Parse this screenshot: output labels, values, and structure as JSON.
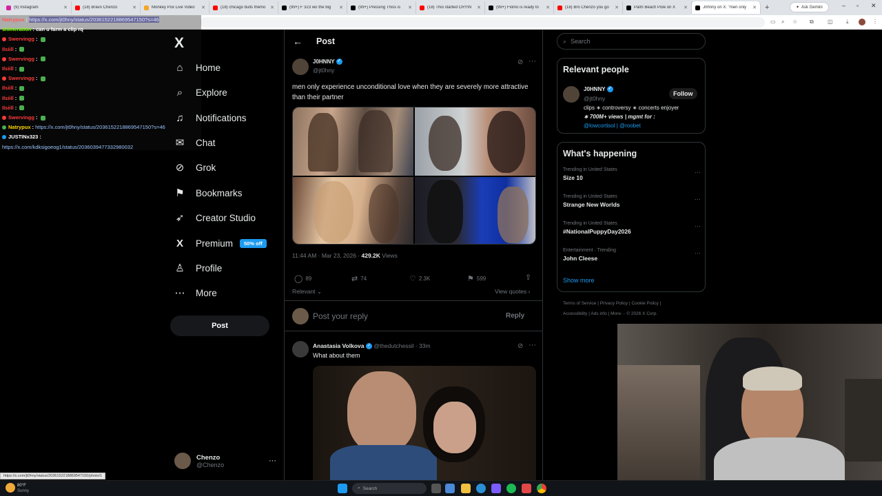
{
  "browser": {
    "tabs": [
      {
        "label": "(9) Instagram",
        "color": "#d6249f"
      },
      {
        "label": "(18) Bravo Chenzo",
        "color": "#ff0000"
      },
      {
        "label": "Monkey Pox Live Video",
        "color": "#f5a623"
      },
      {
        "label": "(18) chicago bulls themo",
        "color": "#ff0000"
      },
      {
        "label": "(99+) F 323 wo the big",
        "color": "#000000"
      },
      {
        "label": "(99+) Pressing Thiss is",
        "color": "#000000"
      },
      {
        "label": "(18) Thio started CRYIN",
        "color": "#ff0000"
      },
      {
        "label": "(99+) Flomo is ready to",
        "color": "#000000"
      },
      {
        "label": "(18) Bro Chenzo you go",
        "color": "#ff0000"
      },
      {
        "label": "Palm Beach Pole on X",
        "color": "#000000"
      },
      {
        "label": "J0hnny on X: \"men only",
        "color": "#000000",
        "active": true
      }
    ],
    "new_tab": "+",
    "gemini_label": "Ask Gemini",
    "status_url": "https://x.com/jt0hny/status/2036152218869547150/photo/1"
  },
  "chat": [
    {
      "user": "Natrypux",
      "user_color": "#ff5a5a",
      "msg": "https://x.com/jt0hny/status/2036152218869547150?s=46",
      "msg_type": "link-highlight",
      "dot": ""
    },
    {
      "user": "shimeration",
      "user_color": "#7cfc00",
      "msg": "can u farm a clip rq",
      "msg_type": "text",
      "dot": ""
    },
    {
      "user": "Swervingg",
      "user_color": "#ff3b3b",
      "msg": "",
      "emote": true,
      "dot": "#ff3b3b"
    },
    {
      "user": "Ilsiill",
      "user_color": "#ff3b3b",
      "msg": "",
      "emote": true,
      "dot": ""
    },
    {
      "user": "Swervingg",
      "user_color": "#ff3b3b",
      "msg": "",
      "emote": true,
      "dot": "#ff3b3b"
    },
    {
      "user": "Ilsiill",
      "user_color": "#ff3b3b",
      "msg": "",
      "emote": true,
      "dot": ""
    },
    {
      "user": "Swervingg",
      "user_color": "#ff3b3b",
      "msg": "",
      "emote": true,
      "dot": "#ff3b3b"
    },
    {
      "user": "Ilsiill",
      "user_color": "#ff3b3b",
      "msg": "",
      "emote": true,
      "dot": ""
    },
    {
      "user": "Ilsiill",
      "user_color": "#ff3b3b",
      "msg": "",
      "emote": true,
      "dot": ""
    },
    {
      "user": "Ilsiill",
      "user_color": "#ff3b3b",
      "msg": "",
      "emote": true,
      "dot": ""
    },
    {
      "user": "Swervingg",
      "user_color": "#ff3b3b",
      "msg": "",
      "emote": true,
      "dot": "#ff3b3b"
    },
    {
      "user": "Natrypux",
      "user_color": "#ffd700",
      "msg": "https://x.com/jt0hny/status/2036152218869547150?s=46",
      "msg_type": "link",
      "dot": "#4caf50"
    },
    {
      "user": "JUSTINx323",
      "user_color": "#ffffff",
      "msg": "",
      "msg_type": "text",
      "dot": "#1d9bf0"
    },
    {
      "user": "",
      "user_color": "#ffffff",
      "msg": "https://x.com/kdksigoeog1/status/2036039477332980032",
      "msg_type": "link",
      "dot": ""
    }
  ],
  "nav": {
    "logo": "X",
    "items": [
      {
        "label": "Home",
        "icon": "⌂",
        "icon_name": "home-icon"
      },
      {
        "label": "Explore",
        "icon": "⌕",
        "icon_name": "explore-icon"
      },
      {
        "label": "Notifications",
        "icon": "♫",
        "icon_name": "bell-icon"
      },
      {
        "label": "Chat",
        "icon": "✉",
        "icon_name": "chat-icon"
      },
      {
        "label": "Grok",
        "icon": "⊘",
        "icon_name": "grok-icon"
      },
      {
        "label": "Bookmarks",
        "icon": "⚑",
        "icon_name": "bookmark-icon"
      },
      {
        "label": "Creator Studio",
        "icon": "➶",
        "icon_name": "rocket-icon"
      },
      {
        "label": "Premium",
        "icon": "X",
        "icon_name": "premium-icon",
        "badge": "50% off"
      },
      {
        "label": "Profile",
        "icon": "♙",
        "icon_name": "profile-icon"
      },
      {
        "label": "More",
        "icon": "⋯",
        "icon_name": "more-icon"
      }
    ],
    "post_button": "Post",
    "me": {
      "name": "Chenzo",
      "handle": "@Chenzo"
    }
  },
  "post": {
    "header": "Post",
    "author": {
      "name": "J0HNNY",
      "handle": "@jt0hny"
    },
    "text": "men only experience unconditional love when they are severely more attractive than their partner",
    "timestamp": "11:44 AM · Mar 23, 2026 ·",
    "views_count": "429.2K",
    "views_label": "Views",
    "actions": {
      "replies": "89",
      "reposts": "74",
      "likes": "2.3K",
      "bookmarks": "599"
    },
    "relevant": "Relevant",
    "view_quotes": "View quotes",
    "reply_placeholder": "Post your reply",
    "reply_button": "Reply"
  },
  "reply": {
    "author": {
      "name": "Anastasia Volkova",
      "handle": "@thedutchessil",
      "time": "· 33m"
    },
    "text": "What about them"
  },
  "right": {
    "search_placeholder": "Search",
    "relevant_people": {
      "title": "Relevant people",
      "name": "J0HNNY",
      "handle": "@jt0hny",
      "follow": "Follow",
      "bio1": "clips ∗ controversy ∗ concerts enjoyer",
      "bio2": "∗ 700M+ views | mgmt for :",
      "bio_links": "@lowcortisol | @roobet"
    },
    "happening": {
      "title": "What's happening",
      "trends": [
        {
          "context": "Trending in United States",
          "name": "Size 10"
        },
        {
          "context": "Trending in United States",
          "name": "Strange New Worlds"
        },
        {
          "context": "Trending in United States",
          "name": "#NationalPuppyDay2026"
        },
        {
          "context": "Entertainment · Trending",
          "name": "John Cleese"
        }
      ],
      "show_more": "Show more"
    },
    "footer1": "Terms of Service  |  Privacy Policy  |  Cookie Policy  |",
    "footer2": "Accessibility  |  Ads info  |  More···  © 2026 X Corp."
  },
  "taskbar": {
    "weather_temp": "80°F",
    "weather_desc": "Sunny",
    "search": "Search"
  },
  "colors": {
    "accent": "#1d9bf0",
    "bg": "#000000",
    "border": "#2f3336"
  }
}
